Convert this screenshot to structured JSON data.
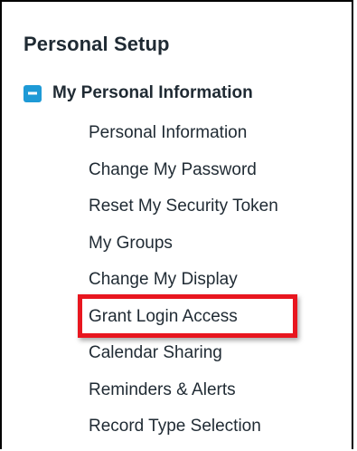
{
  "panel": {
    "title": "Personal Setup"
  },
  "section": {
    "label": "My Personal Information",
    "toggle_icon": "collapse-minus-icon",
    "toggle_color": "#1e9ad6"
  },
  "menu_items": [
    {
      "label": "Personal Information",
      "name": "menu-item-personal-information"
    },
    {
      "label": "Change My Password",
      "name": "menu-item-change-my-password"
    },
    {
      "label": "Reset My Security Token",
      "name": "menu-item-reset-my-security-token"
    },
    {
      "label": "My Groups",
      "name": "menu-item-my-groups"
    },
    {
      "label": "Change My Display",
      "name": "menu-item-change-my-display"
    },
    {
      "label": "Grant Login Access",
      "name": "menu-item-grant-login-access"
    },
    {
      "label": "Calendar Sharing",
      "name": "menu-item-calendar-sharing"
    },
    {
      "label": "Reminders & Alerts",
      "name": "menu-item-reminders-alerts"
    },
    {
      "label": "Record Type Selection",
      "name": "menu-item-record-type-selection"
    }
  ],
  "annotation": {
    "highlighted_item": "Grant Login Access",
    "color": "#e8161f"
  }
}
